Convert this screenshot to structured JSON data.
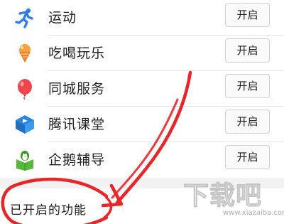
{
  "features": [
    {
      "label": "运动",
      "button": "开启",
      "icon": "running-icon"
    },
    {
      "label": "吃喝玩乐",
      "button": "开启",
      "icon": "ice-cream-icon"
    },
    {
      "label": "同城服务",
      "button": "开启",
      "icon": "balloon-icon"
    },
    {
      "label": "腾讯课堂",
      "button": "开启",
      "icon": "classroom-icon"
    },
    {
      "label": "企鹅辅导",
      "button": "开启",
      "icon": "penguin-book-icon"
    }
  ],
  "enabled_section": {
    "title": "已开启的功能"
  },
  "watermark": {
    "main": "下载吧",
    "url": "www.xiazaiba.com"
  },
  "colors": {
    "annotation_red": "#e8262a",
    "running_blue": "#2f7fe8",
    "icecream_orange": "#f5a23a",
    "balloon_red": "#f0454b",
    "classroom_blue": "#2a86dc",
    "penguin_green": "#55b83a"
  }
}
